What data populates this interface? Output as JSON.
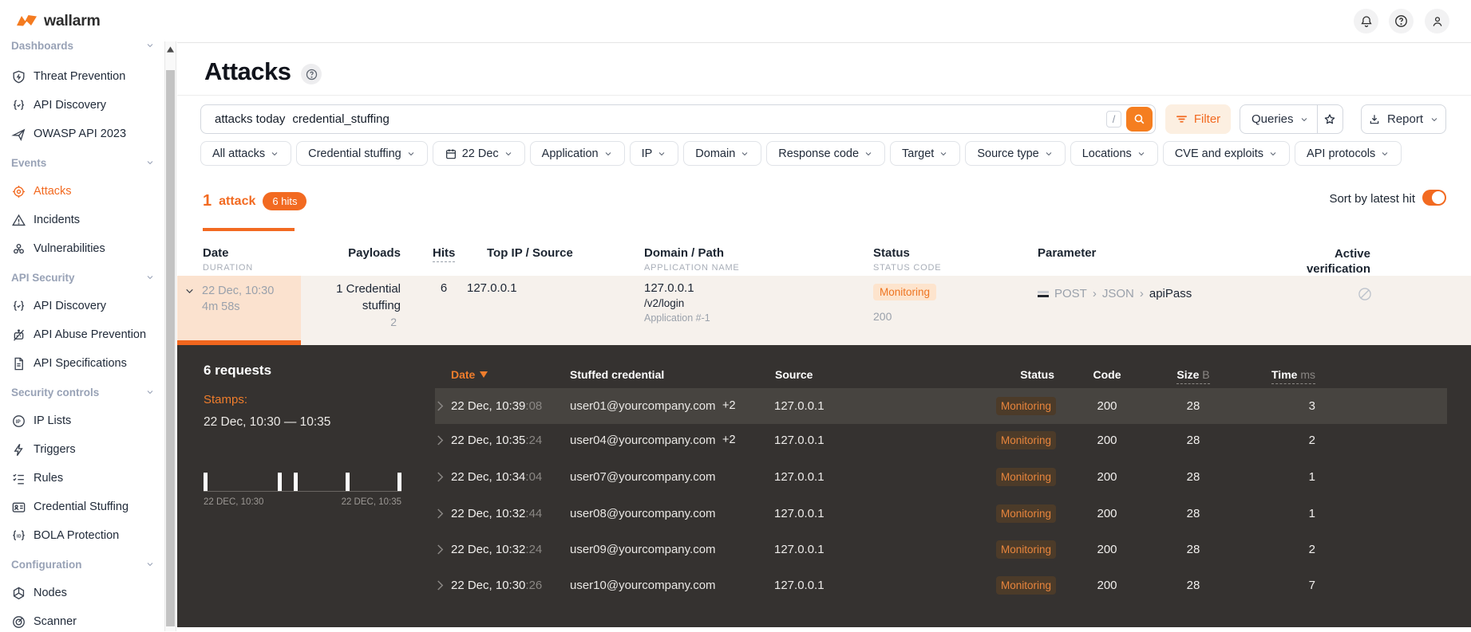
{
  "brand": {
    "name": "wallarm"
  },
  "sidebar": {
    "items": [
      {
        "label": "Dashboards",
        "type": "section"
      },
      {
        "label": "Threat Prevention"
      },
      {
        "label": "API Discovery"
      },
      {
        "label": "OWASP API 2023"
      },
      {
        "label": "Events",
        "type": "section"
      },
      {
        "label": "Attacks",
        "active": true
      },
      {
        "label": "Incidents"
      },
      {
        "label": "Vulnerabilities"
      },
      {
        "label": "API Security",
        "type": "section"
      },
      {
        "label": "API Discovery"
      },
      {
        "label": "API Abuse Prevention"
      },
      {
        "label": "API Specifications"
      },
      {
        "label": "Security controls",
        "type": "section"
      },
      {
        "label": "IP Lists"
      },
      {
        "label": "Triggers"
      },
      {
        "label": "Rules"
      },
      {
        "label": "Credential Stuffing"
      },
      {
        "label": "BOLA Protection"
      },
      {
        "label": "Configuration",
        "type": "section"
      },
      {
        "label": "Nodes"
      },
      {
        "label": "Scanner"
      }
    ]
  },
  "page": {
    "title": "Attacks"
  },
  "search": {
    "tokens": [
      "attacks today",
      "credential_stuffing"
    ],
    "slash_hint": "/"
  },
  "toolbar": {
    "filter_label": "Filter",
    "queries_label": "Queries",
    "report_label": "Report"
  },
  "filters": [
    "All attacks",
    "Credential stuffing",
    "22 Dec",
    "Application",
    "IP",
    "Domain",
    "Response code",
    "Target",
    "Source type",
    "Locations",
    "CVE and exploits",
    "API protocols"
  ],
  "results": {
    "count_number": "1",
    "count_label": "attack",
    "hits_badge": "6 hits",
    "sort_toggle_label": "Sort by latest hit"
  },
  "attacks_table": {
    "headers": {
      "date": "Date",
      "duration": "DURATION",
      "payloads": "Payloads",
      "hits": "Hits",
      "top_ip": "Top IP / Source",
      "domain": "Domain / Path",
      "application_name": "APPLICATION NAME",
      "status": "Status",
      "status_code": "STATUS CODE",
      "parameter": "Parameter",
      "active_verification": "Active verification"
    },
    "row": {
      "date": "22 Dec, 10:30",
      "duration": "4m 58s",
      "payload": "1 Credential stuffing",
      "payload_count": "2",
      "hits": "6",
      "top_ip": "127.0.0.1",
      "domain": "127.0.0.1",
      "path": "/v2/login",
      "application": "Application #-1",
      "status": "Monitoring",
      "status_code": "200",
      "parameter": {
        "method": "POST",
        "sep1": "›",
        "format": "JSON",
        "sep2": "›",
        "name": "apiPass"
      }
    }
  },
  "detail": {
    "title": "6 requests",
    "stamps_label": "Stamps:",
    "stamps_range": "22 Dec, 10:30 — 10:35",
    "histogram": {
      "start_label": "22 DEC, 10:30",
      "end_label": "22 DEC, 10:35"
    },
    "headers": {
      "date": "Date",
      "credential": "Stuffed credential",
      "source": "Source",
      "status": "Status",
      "code": "Code",
      "size": "Size",
      "size_unit": "B",
      "time": "Time",
      "time_unit": "ms"
    },
    "rows": [
      {
        "date": "22 Dec, 10:39",
        "seconds": ":08",
        "credential": "user01@yourcompany.com",
        "extra": "+2",
        "source": "127.0.0.1",
        "status": "Monitoring",
        "code": "200",
        "size": "28",
        "time": "3"
      },
      {
        "date": "22 Dec, 10:35",
        "seconds": ":24",
        "credential": "user04@yourcompany.com",
        "extra": "+2",
        "source": "127.0.0.1",
        "status": "Monitoring",
        "code": "200",
        "size": "28",
        "time": "2"
      },
      {
        "date": "22 Dec, 10:34",
        "seconds": ":04",
        "credential": "user07@yourcompany.com",
        "extra": "",
        "source": "127.0.0.1",
        "status": "Monitoring",
        "code": "200",
        "size": "28",
        "time": "1"
      },
      {
        "date": "22 Dec, 10:32",
        "seconds": ":44",
        "credential": "user08@yourcompany.com",
        "extra": "",
        "source": "127.0.0.1",
        "status": "Monitoring",
        "code": "200",
        "size": "28",
        "time": "1"
      },
      {
        "date": "22 Dec, 10:32",
        "seconds": ":24",
        "credential": "user09@yourcompany.com",
        "extra": "",
        "source": "127.0.0.1",
        "status": "Monitoring",
        "code": "200",
        "size": "28",
        "time": "2"
      },
      {
        "date": "22 Dec, 10:30",
        "seconds": ":26",
        "credential": "user10@yourcompany.com",
        "extra": "",
        "source": "127.0.0.1",
        "status": "Monitoring",
        "code": "200",
        "size": "28",
        "time": "7"
      }
    ]
  }
}
